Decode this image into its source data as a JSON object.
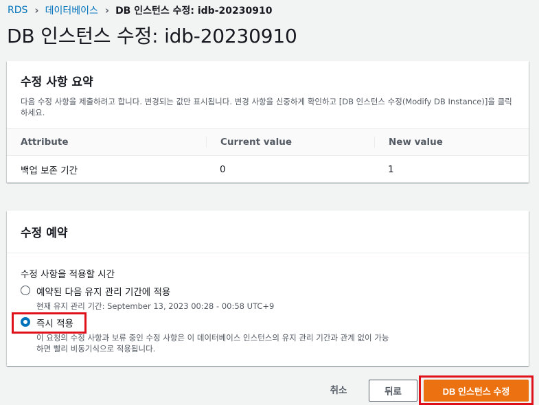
{
  "breadcrumb": {
    "items": [
      "RDS",
      "데이터베이스"
    ],
    "current": "DB 인스턴스 수정: idb-20230910"
  },
  "page_title": "DB 인스턴스 수정: idb-20230910",
  "summary": {
    "title": "수정 사항 요약",
    "description": "다음 수정 사항을 제출하려고 합니다. 변경되는 값만 표시됩니다. 변경 사항을 신중하게 확인하고 [DB 인스턴스 수정(Modify DB Instance)]을 클릭하세요.",
    "columns": [
      "Attribute",
      "Current value",
      "New value"
    ],
    "rows": [
      {
        "attribute": "백업 보존 기간",
        "current": "0",
        "new": "1"
      }
    ]
  },
  "schedule": {
    "title": "수정 예약",
    "field_label": "수정 사항을 적용할 시간",
    "options": [
      {
        "label": "예약된 다음 유지 관리 기간에 적용",
        "sub": "현재 유지 관리 기간: September 13, 2023 00:28 - 00:58 UTC+9",
        "selected": false
      },
      {
        "label": "즉시 적용",
        "sub": "이 요청의 수정 사항과 보류 중인 수정 사항은 이 데이터베이스 인스턴스의 유지 관리 기간과 관계 없이 가능하면 빨리 비동기식으로 적용됩니다.",
        "selected": true
      }
    ]
  },
  "actions": {
    "cancel": "취소",
    "back": "뒤로",
    "submit": "DB 인스턴스 수정"
  },
  "colors": {
    "link": "#0073bb",
    "primary": "#ec7211",
    "highlight": "#e0101a"
  }
}
